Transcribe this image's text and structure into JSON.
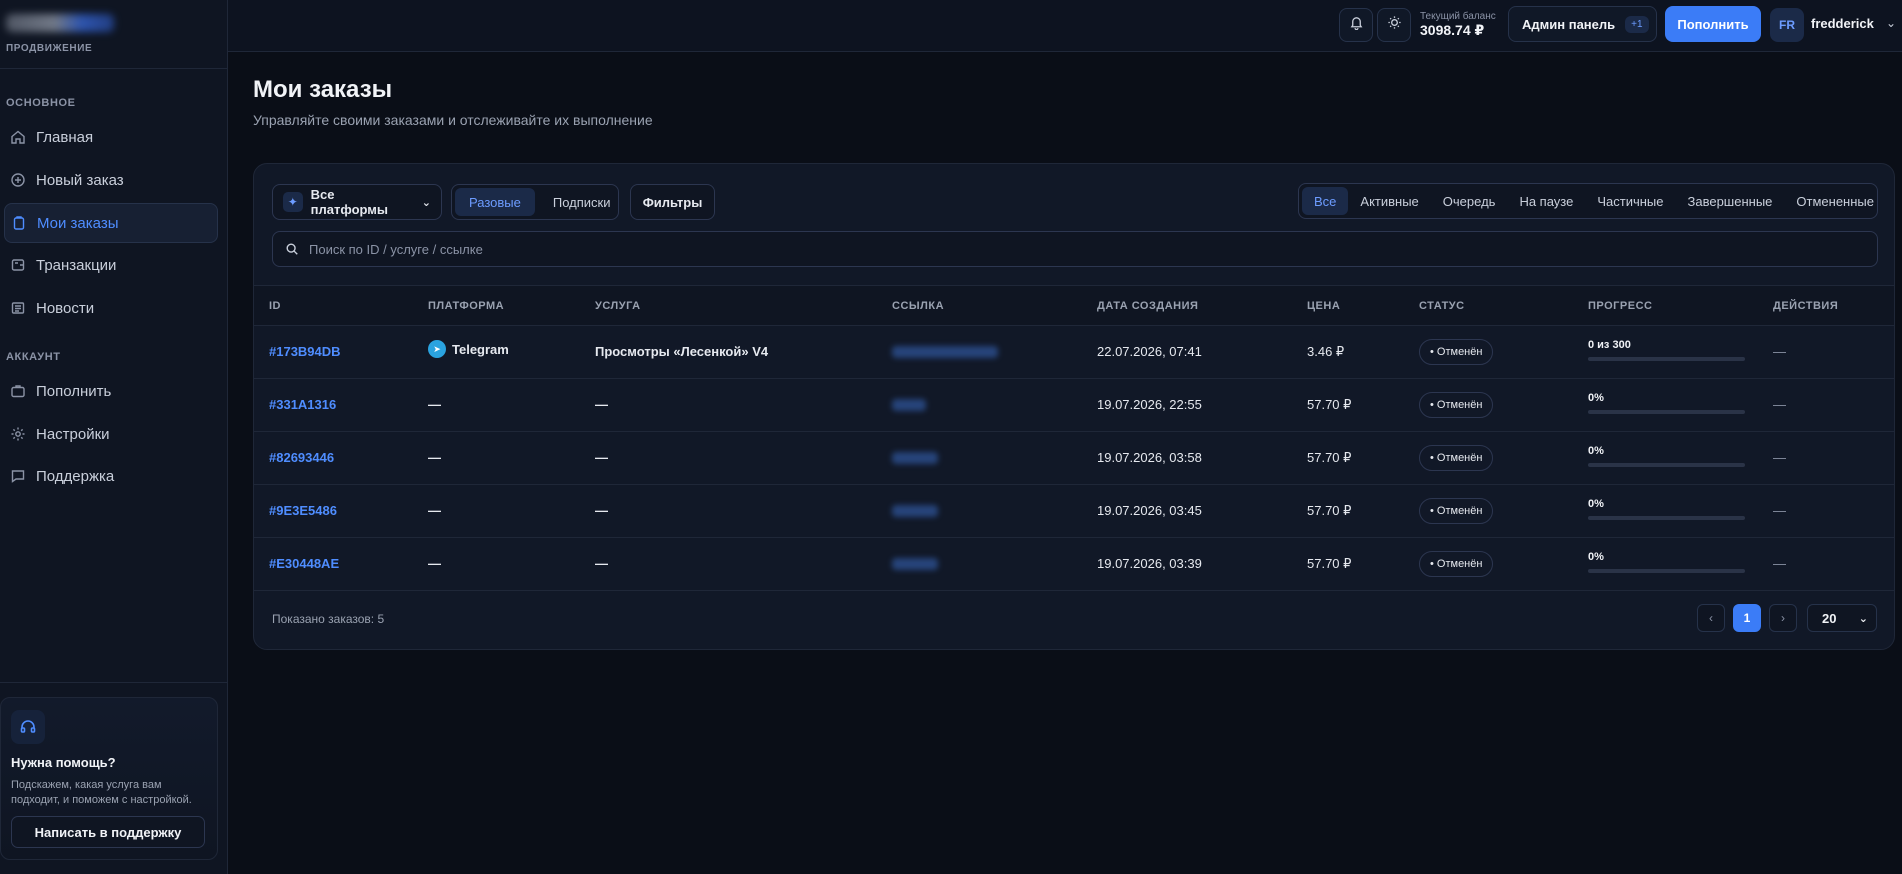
{
  "brand": {
    "subtitle": "ПРОДВИЖЕНИЕ"
  },
  "sidebar": {
    "section_main": "ОСНОВНОЕ",
    "section_account": "АККАУНТ",
    "items": [
      {
        "label": "Главная",
        "icon": "home-icon"
      },
      {
        "label": "Новый заказ",
        "icon": "plus-circle-icon"
      },
      {
        "label": "Мои заказы",
        "icon": "clipboard-icon",
        "active": true
      },
      {
        "label": "Транзакции",
        "icon": "wallet-icon"
      },
      {
        "label": "Новости",
        "icon": "newspaper-icon"
      },
      {
        "label": "Пополнить",
        "icon": "briefcase-icon"
      },
      {
        "label": "Настройки",
        "icon": "gear-icon"
      },
      {
        "label": "Поддержка",
        "icon": "chat-icon"
      }
    ],
    "help": {
      "title": "Нужна помощь?",
      "text": "Подскажем, какая услуга вам подходит, и поможем с настройкой.",
      "button": "Написать в поддержку"
    }
  },
  "header": {
    "balance_label": "Текущий баланс",
    "balance_value": "3098.74 ₽",
    "admin_label": "Админ панель",
    "admin_badge": "+1",
    "topup_label": "Пополнить",
    "avatar_initials": "FR",
    "username": "fredderick"
  },
  "main": {
    "title": "Мои заказы",
    "subtitle": "Управляйте своими заказами и отслеживайте их выполнение",
    "platform_select": "Все платформы",
    "segment": [
      "Разовые",
      "Подписки"
    ],
    "filters_label": "Фильтры",
    "status_tabs": [
      "Все",
      "Активные",
      "Очередь",
      "На паузе",
      "Частичные",
      "Завершенные",
      "Отмененные"
    ],
    "search_placeholder": "Поиск по ID / услуге / ссылке",
    "columns": [
      "ID",
      "ПЛАТФОРМА",
      "УСЛУГА",
      "ССЫЛКА",
      "ДАТА СОЗДАНИЯ",
      "ЦЕНА",
      "СТАТУС",
      "ПРОГРЕСС",
      "ДЕЙСТВИЯ"
    ],
    "orders": [
      {
        "id": "#173B94DB",
        "platform": "Telegram",
        "service": "Просмотры «Лесенкой» V4",
        "date": "22.07.2026, 07:41",
        "price": "3.46 ₽",
        "status": "• Отменён",
        "progress": "0 из 300",
        "progress_fraction": 0,
        "actions": "—"
      },
      {
        "id": "#331A1316",
        "platform": "—",
        "service": "—",
        "date": "19.07.2026, 22:55",
        "price": "57.70 ₽",
        "status": "• Отменён",
        "progress": "0%",
        "progress_fraction": 0,
        "actions": "—"
      },
      {
        "id": "#82693446",
        "platform": "—",
        "service": "—",
        "date": "19.07.2026, 03:58",
        "price": "57.70 ₽",
        "status": "• Отменён",
        "progress": "0%",
        "progress_fraction": 0,
        "actions": "—"
      },
      {
        "id": "#9E3E5486",
        "platform": "—",
        "service": "—",
        "date": "19.07.2026, 03:45",
        "price": "57.70 ₽",
        "status": "• Отменён",
        "progress": "0%",
        "progress_fraction": 0,
        "actions": "—"
      },
      {
        "id": "#E30448AE",
        "platform": "—",
        "service": "—",
        "date": "19.07.2026, 03:39",
        "price": "57.70 ₽",
        "status": "• Отменён",
        "progress": "0%",
        "progress_fraction": 0,
        "actions": "—"
      }
    ],
    "shown_text": "Показано заказов: 5",
    "pagination": {
      "prev": "‹",
      "current": "1",
      "next": "›",
      "per_page": "20"
    }
  }
}
